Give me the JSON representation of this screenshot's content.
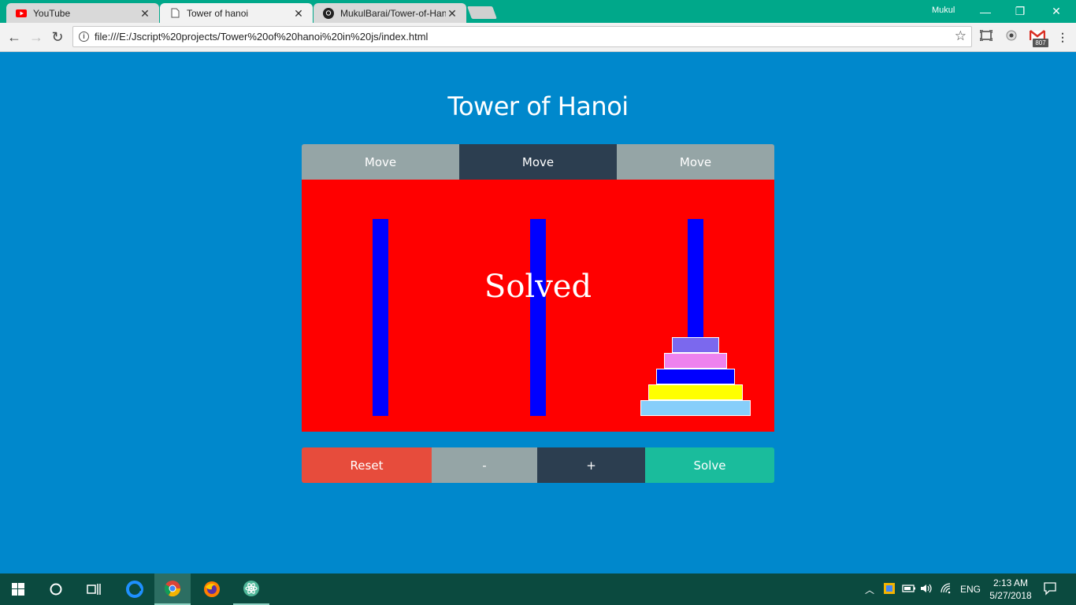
{
  "browser": {
    "tabs": [
      {
        "label": "YouTube",
        "icon": "youtube-icon",
        "active": false
      },
      {
        "label": "Tower of hanoi",
        "icon": "page-icon",
        "active": true
      },
      {
        "label": "MukulBarai/Tower-of-Han",
        "icon": "github-icon",
        "active": false
      }
    ],
    "profile_name": "Mukul",
    "url": "file:///E:/Jscript%20projects/Tower%20of%20hanoi%20in%20js/index.html",
    "gmail_count": "807"
  },
  "page": {
    "title": "Tower of Hanoi",
    "move_buttons": [
      "Move",
      "Move",
      "Move"
    ],
    "status": "Solved",
    "controls": {
      "reset": "Reset",
      "minus": "-",
      "plus": "+",
      "solve": "Solve"
    },
    "disks_on_third_peg_top_to_bottom": [
      "#7b68ee",
      "#ee82ee",
      "#0000ff",
      "#ffff00",
      "#87cefa"
    ],
    "colors": {
      "background": "#0088cc",
      "board": "#ff0000",
      "peg": "#0000ff",
      "move_inactive": "#95a5a6",
      "move_active": "#2c3e50",
      "reset": "#e74c3c",
      "minus": "#95a5a6",
      "plus": "#2c3e50",
      "solve": "#1abc9c"
    }
  },
  "taskbar": {
    "language": "ENG",
    "time": "2:13 AM",
    "date": "5/27/2018"
  }
}
